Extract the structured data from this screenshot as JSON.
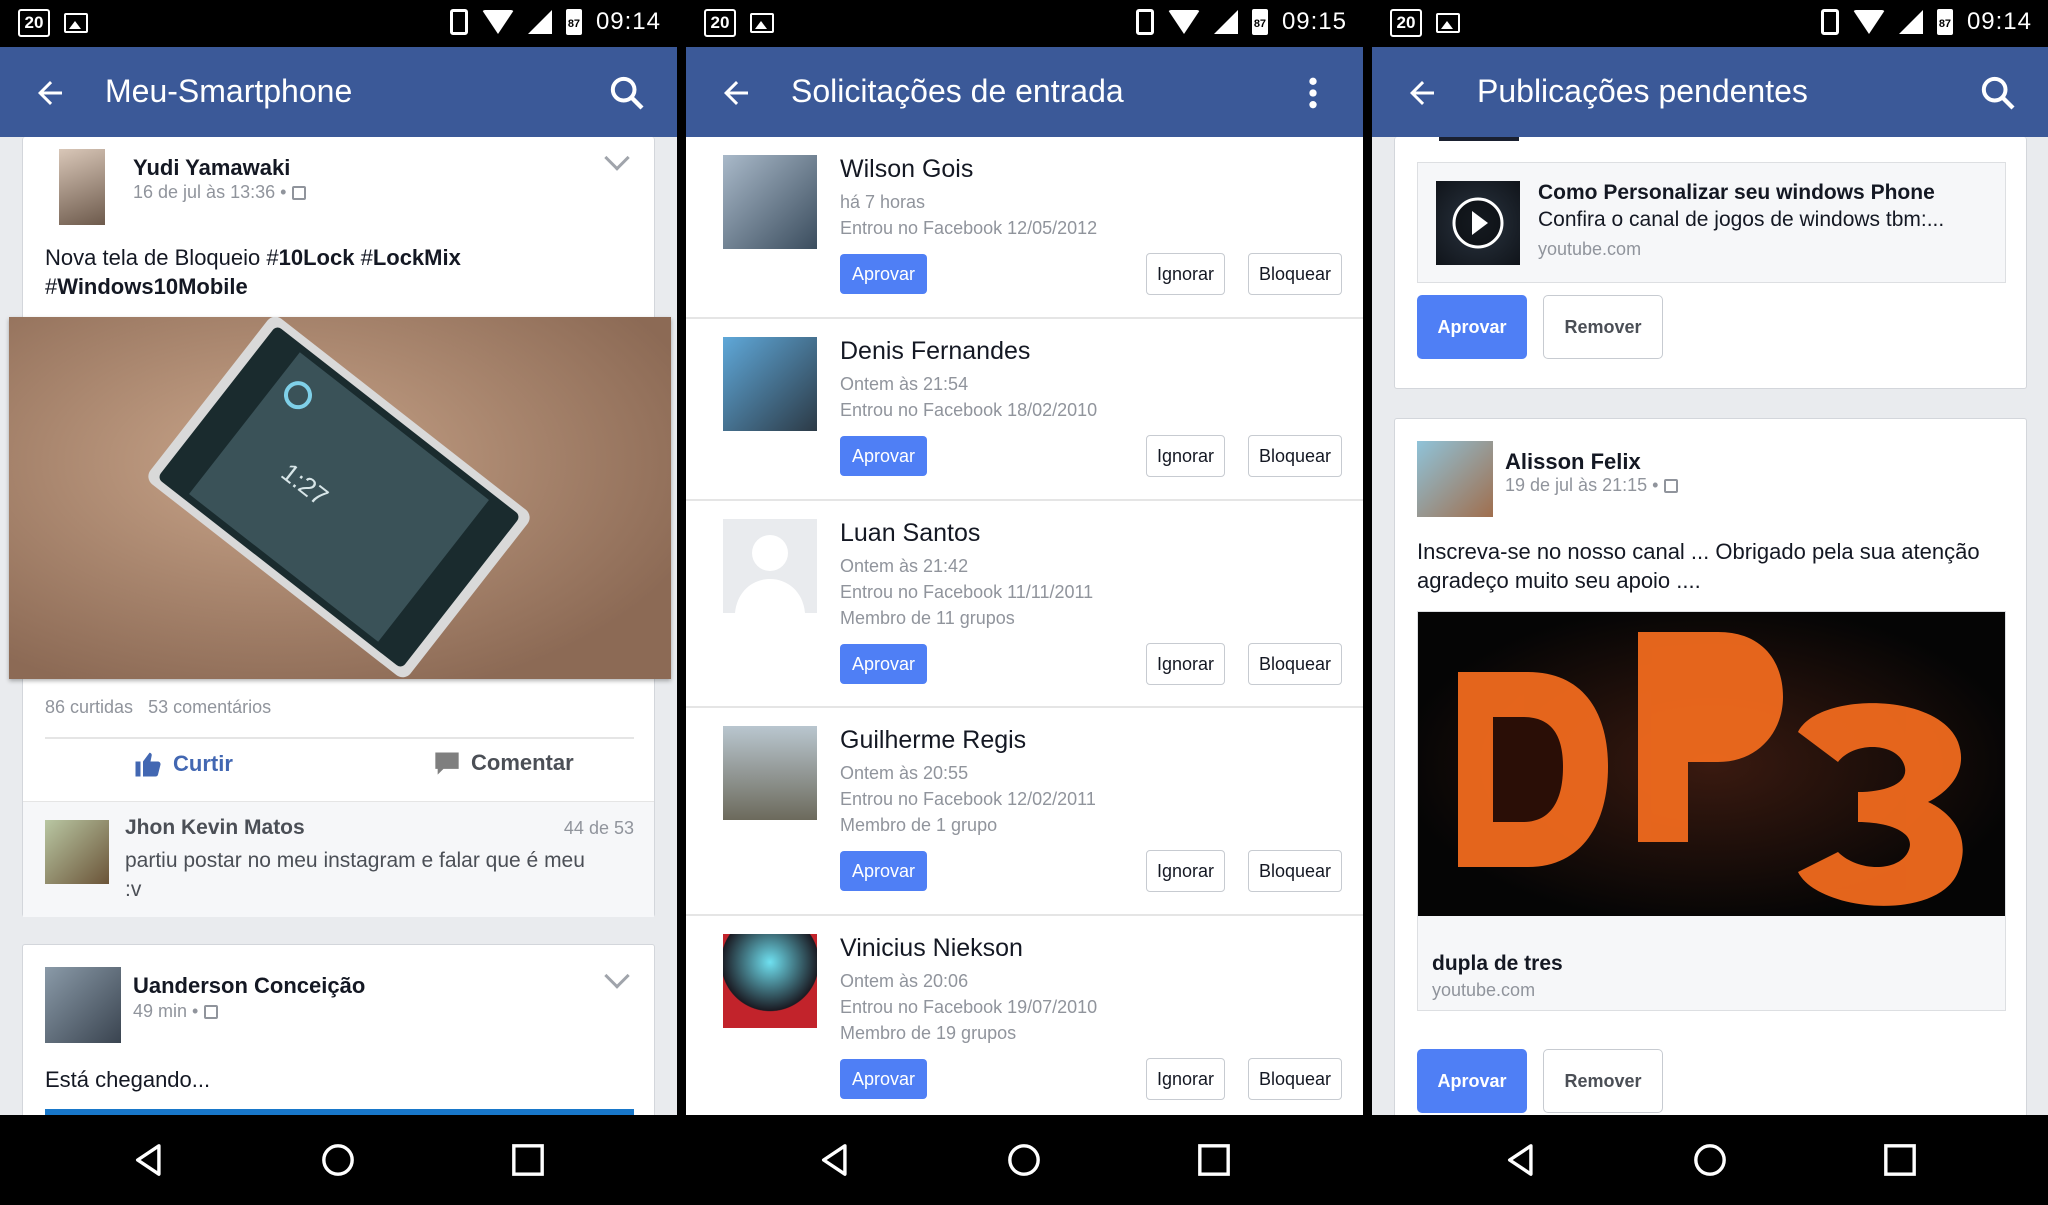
{
  "statusbar": {
    "date": "20",
    "battery": "87",
    "times": [
      "09:14",
      "09:15",
      "09:14"
    ]
  },
  "screen1": {
    "title": "Meu-Smartphone",
    "post": {
      "author": "Yudi Yamawaki",
      "time": "16 de jul às 13:36 •",
      "text_1": "Nova tela de Bloqueio #",
      "text_1_bold": "10Lock",
      "text_1b": " #",
      "text_1b_bold": "LockMix",
      "text_2": "#",
      "text_2_bold": "Windows10Mobile",
      "likes": "86 curtidas",
      "comments": "53 comentários",
      "like_label": "Curtir",
      "comment_label": "Comentar"
    },
    "comment": {
      "author": "Jhon Kevin Matos",
      "counter": "44 de 53",
      "text": "partiu postar no meu instagram e falar que é meu :v"
    },
    "post2": {
      "author": "Uanderson Conceição",
      "time": "49 min •",
      "text": "Está chegando..."
    }
  },
  "screen2": {
    "title": "Solicitações de entrada",
    "approve_label": "Aprovar",
    "ignore_label": "Ignorar",
    "block_label": "Bloquear",
    "requests": [
      {
        "name": "Wilson Gois",
        "lines": [
          "há 7 horas",
          "Entrou no Facebook 12/05/2012"
        ]
      },
      {
        "name": "Denis Fernandes",
        "lines": [
          "Ontem às 21:54",
          "Entrou no Facebook 18/02/2010"
        ]
      },
      {
        "name": "Luan Santos",
        "lines": [
          "Ontem às 21:42",
          "Entrou no Facebook 11/11/2011",
          "Membro de 11 grupos"
        ]
      },
      {
        "name": "Guilherme Regis",
        "lines": [
          "Ontem às 20:55",
          "Entrou no Facebook 12/02/2011",
          "Membro de 1 grupo"
        ]
      },
      {
        "name": "Vinicius Niekson",
        "lines": [
          "Ontem às 20:06",
          "Entrou no Facebook 19/07/2010",
          "Membro de 19 grupos"
        ]
      }
    ]
  },
  "screen3": {
    "title": "Publicações pendentes",
    "approve_label": "Aprovar",
    "remove_label": "Remover",
    "link1": {
      "title": "Como Personalizar seu windows Phone",
      "desc": "Confira o canal de jogos de windows tbm:...",
      "domain": "youtube.com"
    },
    "post": {
      "author": "Alisson Felix",
      "time": "19 de jul às 21:15 •",
      "text": "Inscreva-se no nosso canal ... Obrigado pela sua atenção agradeço muito  seu apoio ....",
      "link_title": "dupla de tres",
      "link_domain": "youtube.com"
    }
  },
  "colors": {
    "facebook_blue": "#3b5998",
    "approve_blue": "#4f7ff5"
  }
}
